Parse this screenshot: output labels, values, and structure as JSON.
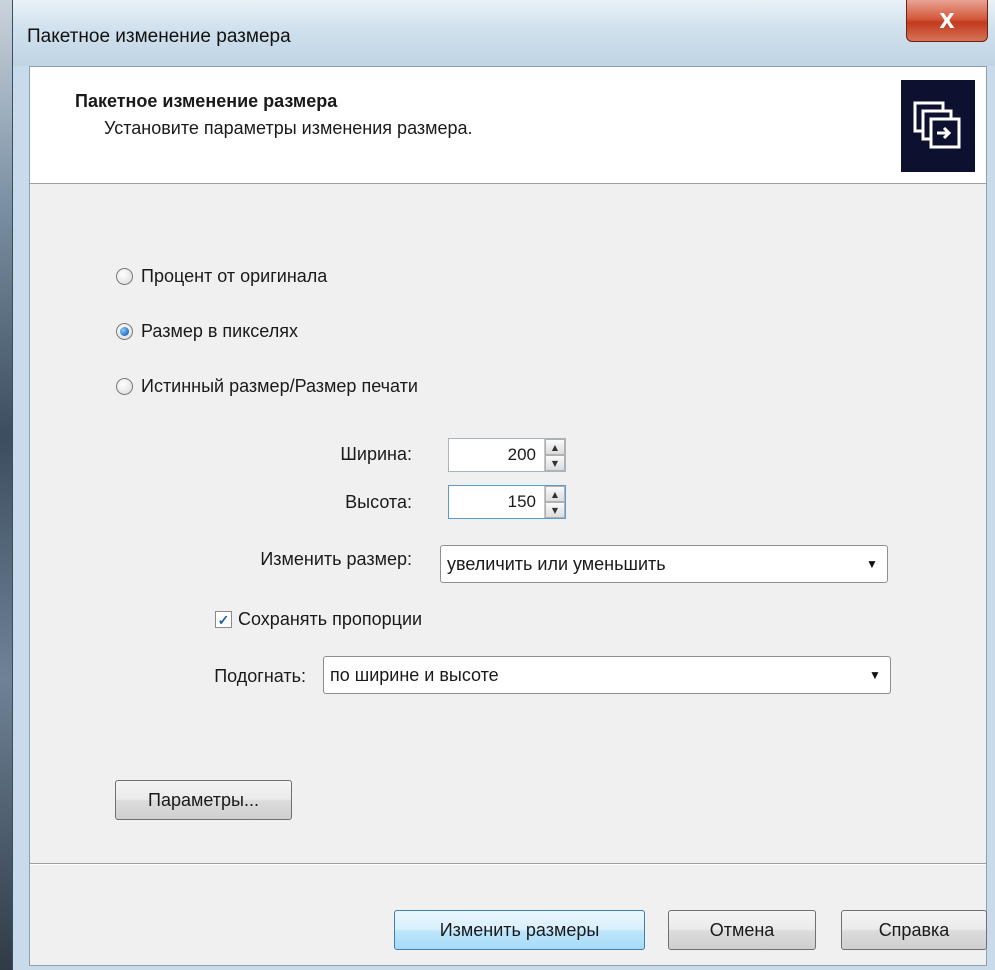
{
  "window": {
    "title": "Пакетное изменение размера",
    "close_label": "X"
  },
  "header": {
    "title": "Пакетное изменение размера",
    "subtitle": "Установите параметры изменения размера.",
    "logo_icon": "batch-resize-icon"
  },
  "mode": {
    "options": [
      {
        "label": "Процент от оригинала",
        "checked": false
      },
      {
        "label": "Размер в пикселях",
        "checked": true
      },
      {
        "label": "Истинный размер/Размер печати",
        "checked": false
      }
    ]
  },
  "size": {
    "width_label": "Ширина:",
    "width_value": "200",
    "height_label": "Высота:",
    "height_value": "150"
  },
  "resize": {
    "label": "Изменить размер:",
    "value": "увеличить или уменьшить"
  },
  "keep_ratio": {
    "label": "Сохранять пропорции",
    "checked": true
  },
  "fit": {
    "label": "Подогнать:",
    "value": "по ширине и высоте"
  },
  "buttons": {
    "params": "Параметры...",
    "resize": "Изменить размеры",
    "cancel": "Отмена",
    "help": "Справка"
  },
  "colors": {
    "header_logo_bg": "#0e1030",
    "radio_selected": "#1f6fc4",
    "default_button": "#bee6fd"
  }
}
